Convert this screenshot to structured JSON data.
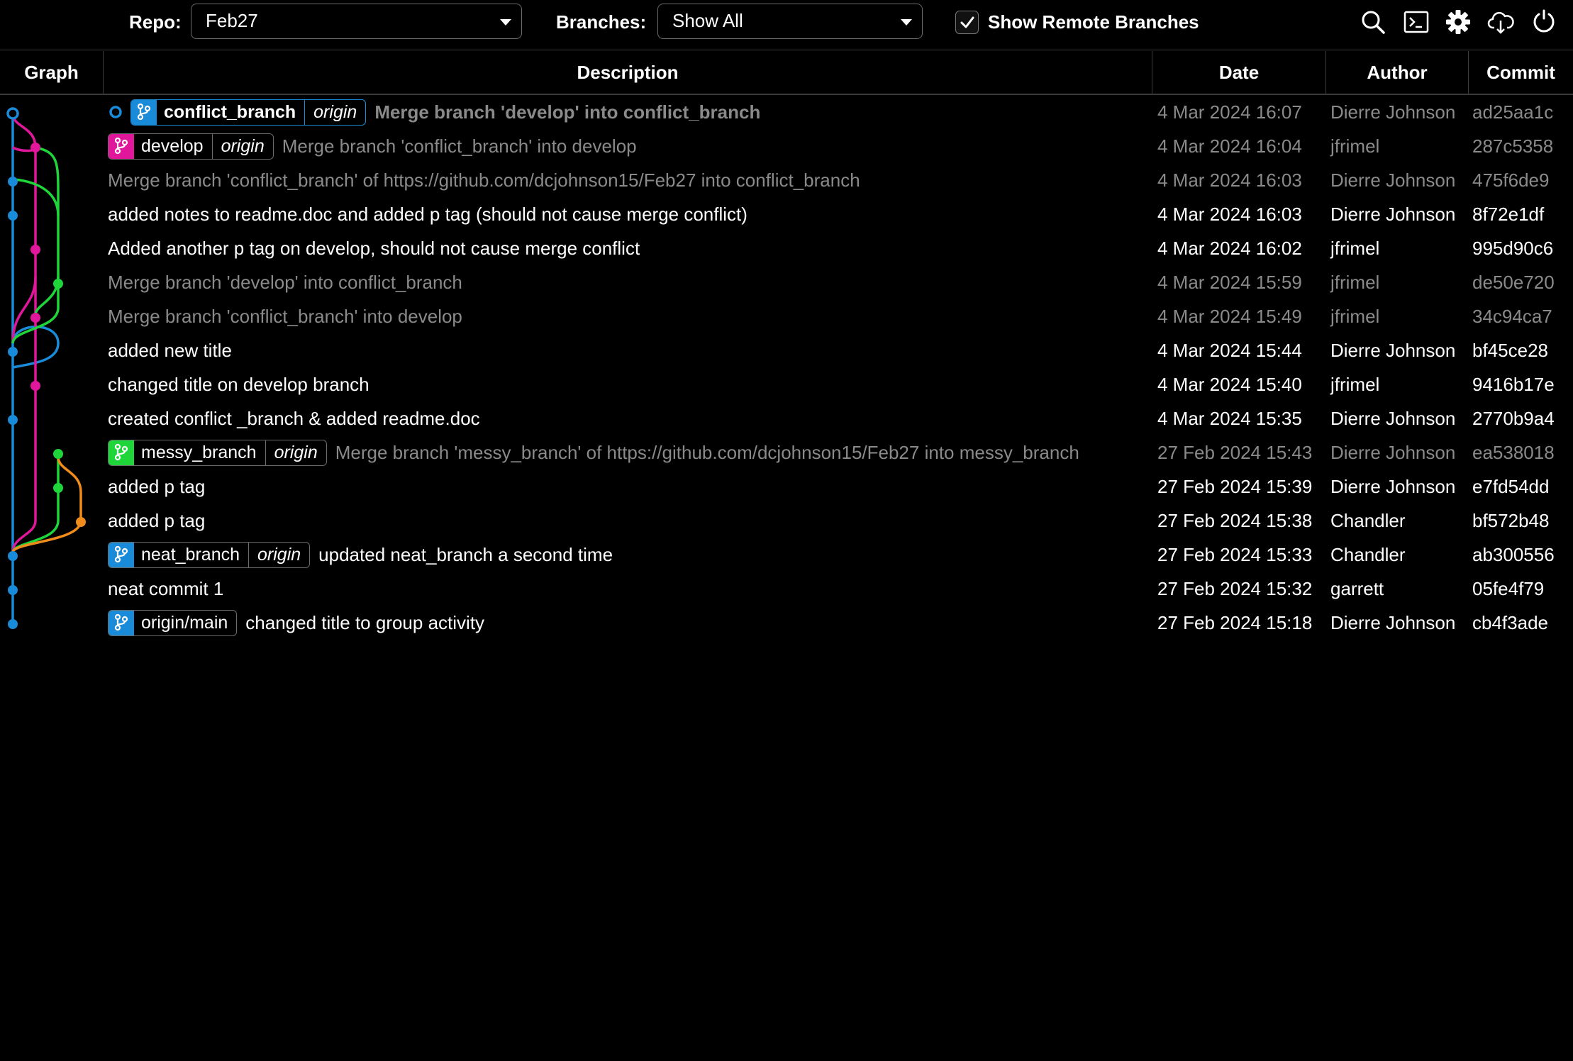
{
  "toolbar": {
    "repo_label": "Repo:",
    "repo_value": "Feb27",
    "branches_label": "Branches:",
    "branches_value": "Show All",
    "show_remote_label": "Show Remote Branches",
    "show_remote_checked": true,
    "icons": [
      "search-icon",
      "terminal-icon",
      "gear-icon",
      "cloud-download-icon",
      "refresh-icon"
    ]
  },
  "columns": {
    "graph": "Graph",
    "description": "Description",
    "date": "Date",
    "author": "Author",
    "commit": "Commit"
  },
  "colors": {
    "blue": "#1a8bd8",
    "magenta": "#e0169b",
    "green": "#1ed63a",
    "orange": "#ef8c1b"
  },
  "commits": [
    {
      "description": "Merge branch 'develop' into conflict_branch",
      "date": "4 Mar 2024 16:07",
      "author": "Dierre Johnson",
      "hash": "ad25aa1c",
      "merge": true,
      "head": true,
      "refs": [
        {
          "name": "conflict_branch",
          "remote": "origin",
          "color": "#1a8bd8",
          "active": true
        }
      ]
    },
    {
      "description": "Merge branch 'conflict_branch' into develop",
      "date": "4 Mar 2024 16:04",
      "author": "jfrimel",
      "hash": "287c5358",
      "merge": true,
      "refs": [
        {
          "name": "develop",
          "remote": "origin",
          "color": "#e0169b"
        }
      ]
    },
    {
      "description": "Merge branch 'conflict_branch' of https://github.com/dcjohnson15/Feb27 into conflict_branch",
      "date": "4 Mar 2024 16:03",
      "author": "Dierre Johnson",
      "hash": "475f6de9",
      "merge": true,
      "refs": []
    },
    {
      "description": "added notes to readme.doc and added p tag (should not cause merge conflict)",
      "date": "4 Mar 2024 16:03",
      "author": "Dierre Johnson",
      "hash": "8f72e1df",
      "merge": false,
      "refs": []
    },
    {
      "description": "Added another p tag on develop, should not cause merge conflict",
      "date": "4 Mar 2024 16:02",
      "author": "jfrimel",
      "hash": "995d90c6",
      "merge": false,
      "refs": []
    },
    {
      "description": "Merge branch 'develop' into conflict_branch",
      "date": "4 Mar 2024 15:59",
      "author": "jfrimel",
      "hash": "de50e720",
      "merge": true,
      "refs": []
    },
    {
      "description": "Merge branch 'conflict_branch' into develop",
      "date": "4 Mar 2024 15:49",
      "author": "jfrimel",
      "hash": "34c94ca7",
      "merge": true,
      "refs": []
    },
    {
      "description": "added new title",
      "date": "4 Mar 2024 15:44",
      "author": "Dierre Johnson",
      "hash": "bf45ce28",
      "merge": false,
      "refs": []
    },
    {
      "description": "changed title on develop branch",
      "date": "4 Mar 2024 15:40",
      "author": "jfrimel",
      "hash": "9416b17e",
      "merge": false,
      "refs": []
    },
    {
      "description": "created conflict _branch & added readme.doc",
      "date": "4 Mar 2024 15:35",
      "author": "Dierre Johnson",
      "hash": "2770b9a4",
      "merge": false,
      "refs": []
    },
    {
      "description": "Merge branch 'messy_branch' of https://github.com/dcjohnson15/Feb27 into messy_branch",
      "date": "27 Feb 2024 15:43",
      "author": "Dierre Johnson",
      "hash": "ea538018",
      "merge": true,
      "refs": [
        {
          "name": "messy_branch",
          "remote": "origin",
          "color": "#1ed63a"
        }
      ]
    },
    {
      "description": "added p tag",
      "date": "27 Feb 2024 15:39",
      "author": "Dierre Johnson",
      "hash": "e7fd54dd",
      "merge": false,
      "refs": []
    },
    {
      "description": "added p tag",
      "date": "27 Feb 2024 15:38",
      "author": "Chandler",
      "hash": "bf572b48",
      "merge": false,
      "refs": []
    },
    {
      "description": "updated neat_branch a second time",
      "date": "27 Feb 2024 15:33",
      "author": "Chandler",
      "hash": "ab300556",
      "merge": false,
      "refs": [
        {
          "name": "neat_branch",
          "remote": "origin",
          "color": "#1a8bd8"
        }
      ]
    },
    {
      "description": "neat commit 1",
      "date": "27 Feb 2024 15:32",
      "author": "garrett",
      "hash": "05fe4f79",
      "merge": false,
      "refs": []
    },
    {
      "description": "changed title to group activity",
      "date": "27 Feb 2024 15:18",
      "author": "Dierre Johnson",
      "hash": "cb4f3ade",
      "merge": false,
      "refs": [
        {
          "name": "origin/main",
          "remote": "",
          "color": "#1a8bd8"
        }
      ]
    }
  ]
}
